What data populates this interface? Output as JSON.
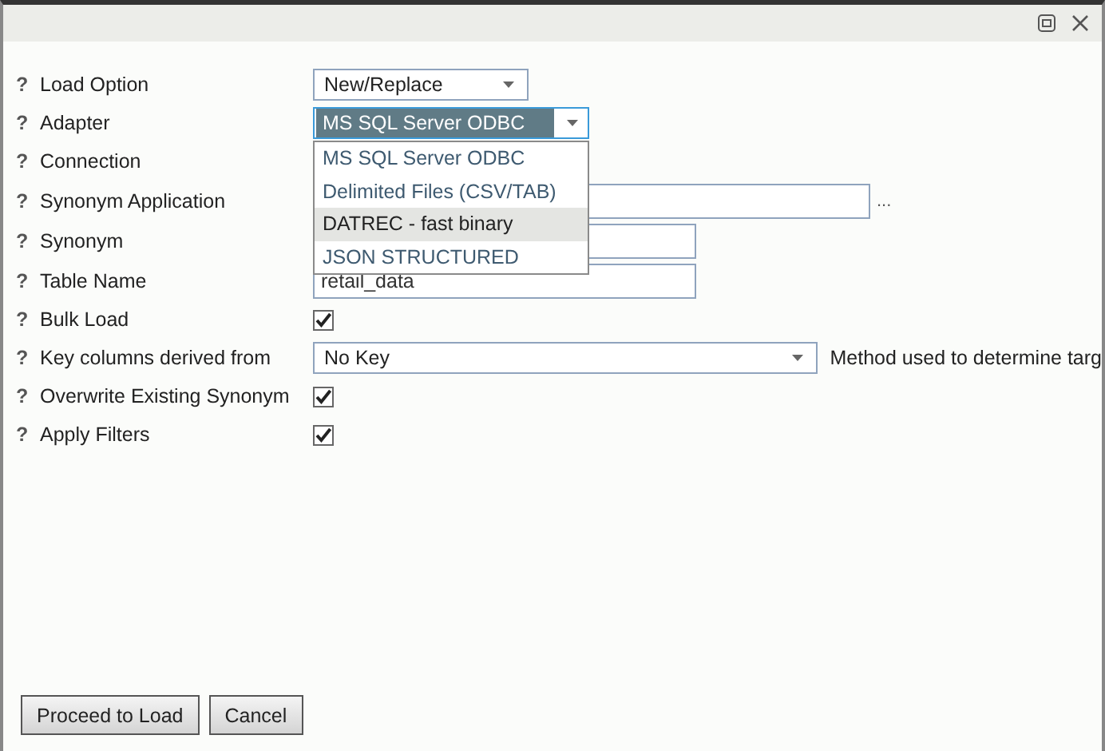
{
  "window": {
    "buttons": [
      {
        "kind": "restore"
      },
      {
        "kind": "close"
      }
    ]
  },
  "rows": [
    {
      "kind": "select",
      "label": "Load Option",
      "value": "New/Replace"
    },
    {
      "kind": "open_select",
      "label": "Adapter",
      "value": "MS SQL Server ODBC",
      "options": [
        {
          "label": "MS SQL Server ODBC",
          "highlighted": false
        },
        {
          "label": "Delimited Files (CSV/TAB)",
          "highlighted": false
        },
        {
          "label": "DATREC - fast binary",
          "highlighted": true
        },
        {
          "label": "JSON STRUCTURED",
          "highlighted": false
        }
      ]
    },
    {
      "kind": "blank",
      "label": "Connection"
    },
    {
      "kind": "browse",
      "label": "Synonym Application",
      "browse": "..."
    },
    {
      "kind": "input",
      "label": "Synonym"
    },
    {
      "kind": "input",
      "label": "Table Name",
      "value": "retail_data"
    },
    {
      "kind": "checkbox",
      "label": "Bulk Load",
      "checked": true
    },
    {
      "kind": "wide_select",
      "label": "Key columns derived from",
      "value": "No Key",
      "note": "Method used to determine targ"
    },
    {
      "kind": "checkbox",
      "label": "Overwrite Existing Synonym",
      "checked": true
    },
    {
      "kind": "checkbox",
      "label": "Apply Filters",
      "checked": true
    }
  ],
  "help_mark": "?",
  "buttons": [
    "Proceed to Load",
    "Cancel"
  ]
}
